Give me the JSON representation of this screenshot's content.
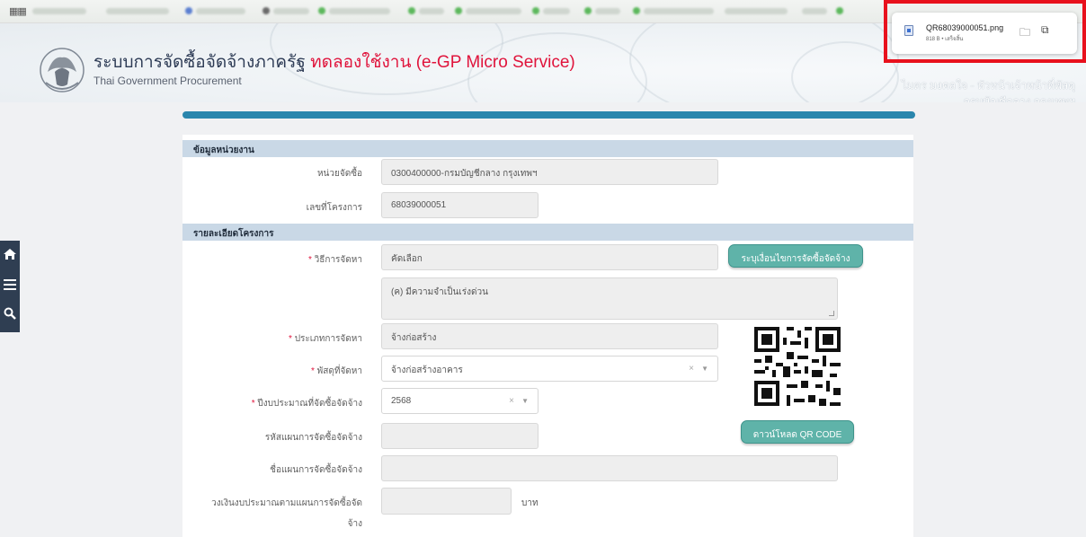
{
  "topbar": {
    "apps_icon": "apps-grid-icon"
  },
  "header": {
    "title_main": "ระบบการจัดซื้อจัดจ้างภาครัฐ",
    "title_trial": "ทดลองใช้งาน (e-GP Micro Service)",
    "title_en": "Thai Government Procurement",
    "user_role": "ไมตร มงคลใจ - หัวหน้าเจ้าหน้าที่พัสดุ",
    "user_org": "กรมบัญชีกลาง กรุงเทพฯ"
  },
  "download": {
    "file_name": "QR68039000051.png",
    "meta": "818 B • เสร็จสิ้น",
    "highlight_color": "#e8111d"
  },
  "sidenav": {
    "items": [
      "home-icon",
      "menu-icon",
      "search-icon"
    ]
  },
  "sections": {
    "agency": "ข้อมูลหน่วยงาน",
    "project": "รายละเอียดโครงการ"
  },
  "fields": {
    "agency_label": "หน่วยจัดซื้อ",
    "agency_value": "0300400000-กรมบัญชีกลาง กรุงเทพฯ",
    "project_no_label": "เลขที่โครงการ",
    "project_no_value": "68039000051",
    "method_label": "วิธีการจัดหา",
    "method_value": "คัดเลือก",
    "method_reason": "(ค) มีความจำเป็นเร่งด่วน",
    "type_label": "ประเภทการจัดหา",
    "type_value": "จ้างก่อสร้าง",
    "item_label": "พัสดุที่จัดหา",
    "item_value": "จ้างก่อสร้างอาคาร",
    "year_label": "ปีงบประมาณที่จัดซื้อจัดจ้าง",
    "year_value": "2568",
    "plan_code_label": "รหัสแผนการจัดซื้อจัดจ้าง",
    "plan_code_value": "",
    "plan_name_label": "ชื่อแผนการจัดซื้อจัดจ้าง",
    "plan_name_value": "",
    "budget_label_1": "วงเงินงบประมาณตามแผนการจัดซื้อจัด",
    "budget_label_2": "จ้าง",
    "budget_value": "",
    "budget_unit": "บาท"
  },
  "buttons": {
    "conditions": "ระบุเงื่อนไขการจัดซื้อจัดจ้าง",
    "download_qr": "ดาวน์โหลด QR CODE"
  },
  "symbols": {
    "required": "*",
    "clear": "×",
    "caret": "▼"
  },
  "colors": {
    "accent": "#2a86ad",
    "button": "#5fb3a9",
    "required": "#e0143c",
    "trial_text": "#e0143c"
  }
}
